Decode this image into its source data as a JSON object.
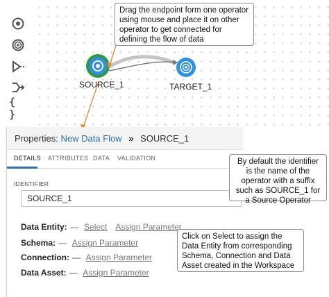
{
  "canvas": {
    "source_label": "SOURCE_1",
    "target_label": "TARGET_1"
  },
  "toolbar": {
    "icons": [
      "source-operator-icon",
      "target-operator-icon",
      "filter-operator-icon",
      "join-operator-icon",
      "expression-operator-icon"
    ],
    "expression_glyph": "{ }"
  },
  "callouts": {
    "drag": "Drag the endpoint form one operator using mouse and place it on other operator to get connected for defining the flow of data",
    "identifier": "By default the identifier is the name of the operator with a suffix such as SOURCE_1 for a Source Operator",
    "select": "Click on Select to assign the Data Entity from corresponding Schema, Connection and Data Asset created in the Workspace"
  },
  "properties": {
    "prefix": "Properties:",
    "flow_link": "New Data Flow",
    "separator": "»",
    "node": "SOURCE_1",
    "tabs": [
      "DETAILS",
      "ATTRIBUTES",
      "DATA",
      "VALIDATION"
    ],
    "identifier_label": "IDENTIFIER",
    "identifier_value": "SOURCE_1",
    "rows": {
      "data_entity": {
        "label": "Data Entity:",
        "dash": "—",
        "select": "Select",
        "assign": "Assign Parameter"
      },
      "schema": {
        "label": "Schema:",
        "dash": "—",
        "assign": "Assign Parameter"
      },
      "connection": {
        "label": "Connection:",
        "dash": "—",
        "assign": "Assign Parameter"
      },
      "data_asset": {
        "label": "Data Asset:",
        "dash": "—",
        "assign": "Assign Parameter"
      }
    }
  },
  "colors": {
    "source_ring": "#2e9a3e",
    "operator_blue": "#2f8fe0",
    "link_blue": "#2f6fad",
    "arrow_orange": "#e58a3a"
  }
}
